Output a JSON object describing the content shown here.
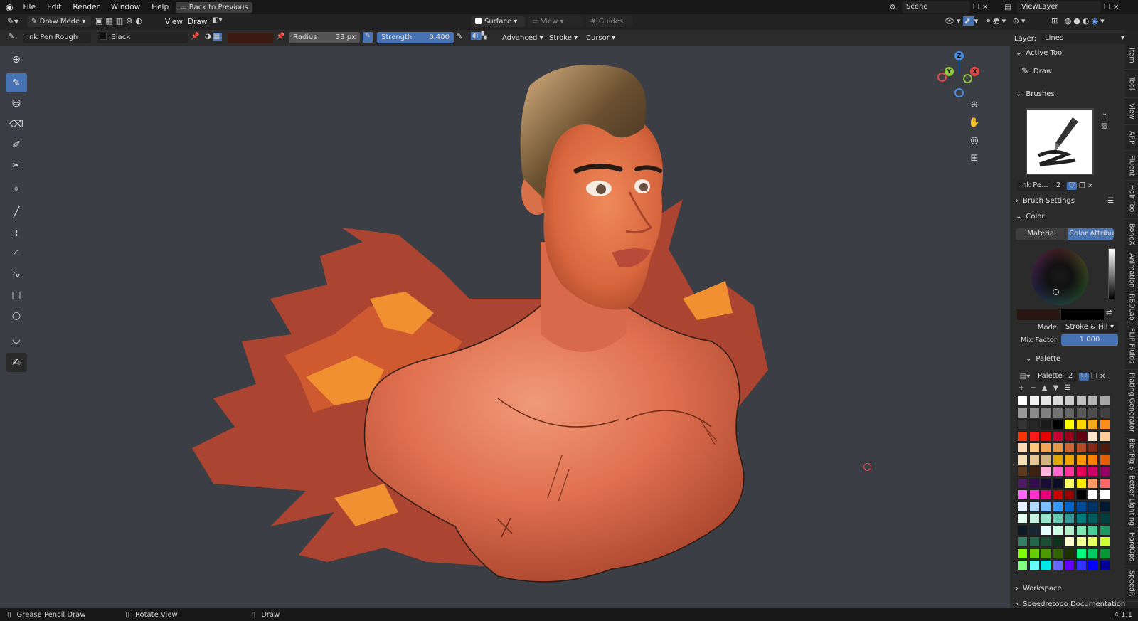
{
  "menu": {
    "items": [
      "File",
      "Edit",
      "Render",
      "Window",
      "Help"
    ],
    "back_button": "Back to Previous",
    "scene_label": "Scene",
    "viewlayer_label": "ViewLayer"
  },
  "header": {
    "mode": "Draw Mode",
    "view_menu": "View",
    "draw_menu": "Draw",
    "placement": "Surface",
    "view_dropdown": "View",
    "guides": "Guides"
  },
  "tool_settings": {
    "brush_name": "Ink Pen Rough",
    "material": "Black",
    "radius_label": "Radius",
    "radius_value": "33 px",
    "strength_label": "Strength",
    "strength_value": "0.400",
    "advanced": "Advanced",
    "stroke": "Stroke",
    "cursor": "Cursor"
  },
  "npanel": {
    "layer_label": "Layer:",
    "layer_value": "Lines",
    "active_tool_title": "Active Tool",
    "active_tool_name": "Draw",
    "brushes_title": "Brushes",
    "brush_short": "Ink Pe...",
    "brush_users": "2",
    "brush_settings_title": "Brush Settings",
    "color_title": "Color",
    "tab_material": "Material",
    "tab_color_attribute": "Color Attribute",
    "mode_label": "Mode",
    "mode_value": "Stroke & Fill",
    "mix_factor_label": "Mix Factor",
    "mix_factor_value": "1.000",
    "palette_title": "Palette",
    "palette_name": "Palette",
    "palette_users": "2",
    "workspace_title": "Workspace",
    "speedretopo_title": "Speedretopo Documentation"
  },
  "side_tabs": [
    "Item",
    "Tool",
    "View",
    "ARP",
    "Fluent",
    "Hair Tool",
    "BoneX",
    "Animation",
    "RBDLab",
    "FLIP Fluids",
    "Plating Generator",
    "BlenRig 6",
    "Better Lighting",
    "HardOps",
    "SpeedR"
  ],
  "palette_colors": [
    "#ffffff",
    "#f2f2f2",
    "#e6e6e6",
    "#d9d9d9",
    "#cccccc",
    "#bfbfbf",
    "#b3b3b3",
    "#a6a6a6",
    "#999999",
    "#8c8c8c",
    "#808080",
    "#737373",
    "#666666",
    "#595959",
    "#4d4d4d",
    "#404040",
    "#333333",
    "#262626",
    "#1a1a1a",
    "#000000",
    "#ffff00",
    "#ffd700",
    "#f5a623",
    "#ff8c1a",
    "#ff3300",
    "#ff1a1a",
    "#e60000",
    "#cc0033",
    "#99001a",
    "#660011",
    "#ffe6cc",
    "#ffcc99",
    "#ffd9b3",
    "#ffc680",
    "#f2a65a",
    "#e69545",
    "#cc6633",
    "#b34d26",
    "#802b1a",
    "#4d1a0d",
    "#f5deb3",
    "#e6c89a",
    "#d4b483",
    "#e0a800",
    "#f0a500",
    "#ff9900",
    "#ff8000",
    "#e65c00",
    "#5c3a1e",
    "#3d2412",
    "#ffb3d9",
    "#ff66cc",
    "#ff3399",
    "#e6005c",
    "#cc0066",
    "#990066",
    "#4d1a66",
    "#330d4d",
    "#1a0d33",
    "#0d0d26",
    "#ffff66",
    "#ffee00",
    "#ff9966",
    "#ff6666",
    "#ff66ff",
    "#ff33cc",
    "#e6007a",
    "#cc0000",
    "#990000",
    "#000000",
    "#ffffff",
    "#ffffff",
    "#e6f2ff",
    "#b3d9ff",
    "#80bfff",
    "#3399ff",
    "#0066cc",
    "#004c99",
    "#003366",
    "#001a33",
    "#e6fff2",
    "#ccf2e6",
    "#99e6cc",
    "#66ccb3",
    "#339999",
    "#007a7a",
    "#005c5c",
    "#003d3d",
    "#0d1a26",
    "#1a2633",
    "#e6ffff",
    "#ccffe6",
    "#b3f2cc",
    "#80e6b3",
    "#4dcc99",
    "#1a9966",
    "#338066",
    "#26664d",
    "#1a4d33",
    "#0d331a",
    "#ffffcc",
    "#f2ff99",
    "#e6ff66",
    "#ccff33",
    "#80ff00",
    "#66cc00",
    "#4d9900",
    "#336600",
    "#1a3300",
    "#00ff80",
    "#00cc66",
    "#009933",
    "#80ff80",
    "#66ffff",
    "#00e6e6",
    "#6666ff",
    "#6600ff",
    "#3333ff",
    "#0000ff",
    "#000099"
  ],
  "status": {
    "left_action": "Grease Pencil Draw",
    "middle_action": "Rotate View",
    "right_action": "Draw",
    "version": "4.1.1"
  },
  "accent_color": "#4772b3"
}
